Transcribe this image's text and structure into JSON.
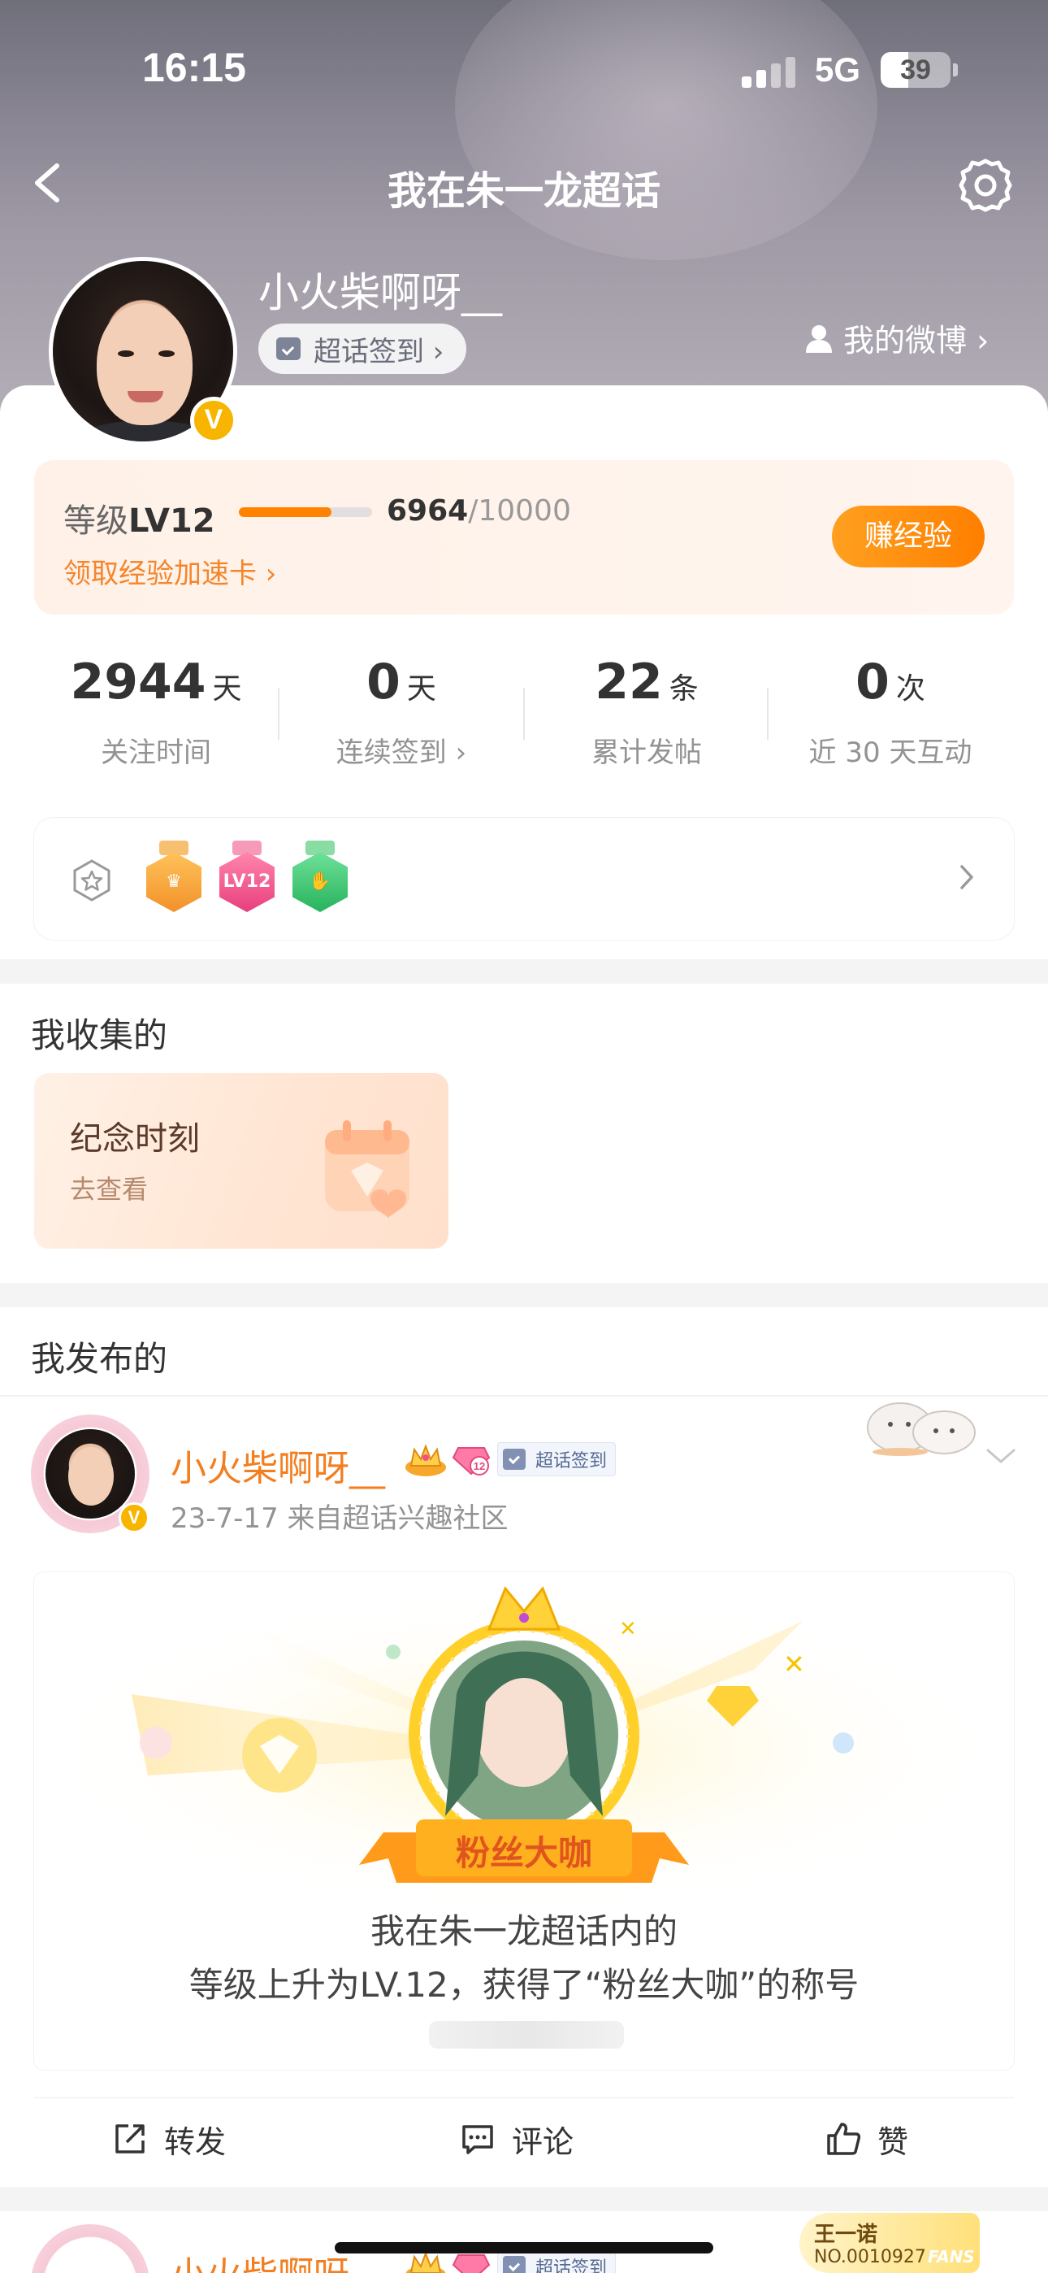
{
  "status_bar": {
    "time": "16:15",
    "network": "5G",
    "battery": "39",
    "battery_level": 0.39
  },
  "nav": {
    "title": "我在朱一龙超话"
  },
  "profile": {
    "name": "小火柴啊呀__",
    "checkin_label": "超话签到 ›",
    "my_weibo_label": "我的微博 ›",
    "verified_mark": "V"
  },
  "level": {
    "label": "等级",
    "value": "LV12",
    "xp_current": "6964",
    "xp_total": "/10000",
    "xp_fraction": 0.6964,
    "accel_link": "领取经验加速卡 ›",
    "earn_button": "赚经验"
  },
  "stats": [
    {
      "value": "2944",
      "unit": "天",
      "label": "关注时间"
    },
    {
      "value": "0",
      "unit": "天",
      "label": "连续签到 ›"
    },
    {
      "value": "22",
      "unit": "条",
      "label": "累计发帖"
    },
    {
      "value": "0",
      "unit": "次",
      "label": "近 30 天互动"
    }
  ],
  "badges": {
    "items": [
      {
        "icon": "crown-medal-icon",
        "color": "#f5a623"
      },
      {
        "icon": "lv12-medal-icon",
        "color": "#f0508a",
        "text": "LV12"
      },
      {
        "icon": "hand-medal-icon",
        "color": "#35c26a"
      }
    ]
  },
  "collections": {
    "title": "我收集的",
    "card_title": "纪念时刻",
    "card_sub": "去查看"
  },
  "published": {
    "title": "我发布的"
  },
  "post": {
    "author": "小火柴啊呀__",
    "checkin_tag": "超话签到",
    "meta": "23-7-17  来自超话兴趣社区",
    "banner_text": "粉丝大咖",
    "line1": "我在朱一龙超话内的",
    "line2": "等级上升为LV.12，获得了“粉丝大咖”的称号",
    "actions": {
      "repost": "转发",
      "comment": "评论",
      "like": "赞"
    }
  },
  "next_post": {
    "author": "小火柴啊呀__",
    "checkin_tag": "超话签到",
    "fans_card_name": "王一诺",
    "fans_card_no": "NO.0010927",
    "fans_card_logo": "FANS"
  },
  "colors": {
    "accent": "#ff8200",
    "name_orange": "#f37e20",
    "verified": "#f7b500"
  }
}
